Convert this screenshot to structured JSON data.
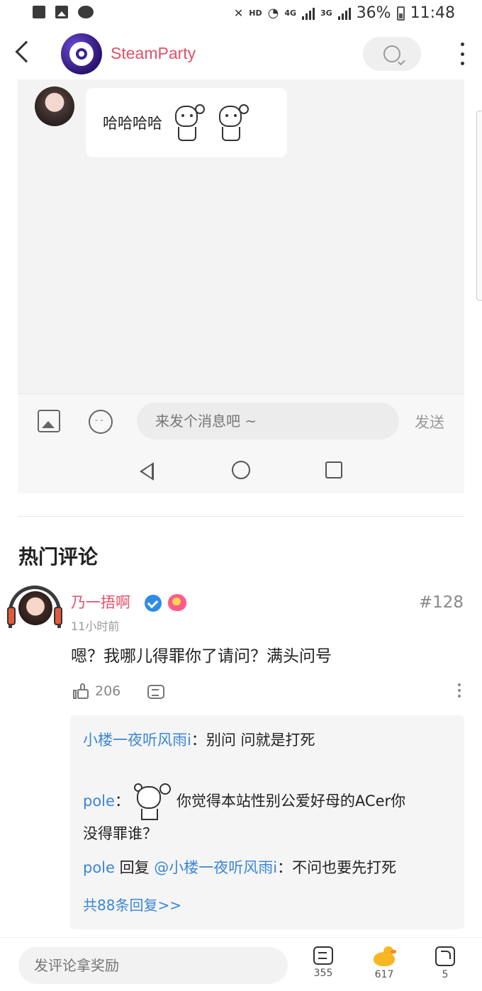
{
  "status_bar": {
    "net_label": "HD",
    "signal_4g": "4G",
    "signal_3g": "3G",
    "battery": "36%",
    "time": "11:48"
  },
  "header": {
    "title": "SteamParty"
  },
  "embedded_chat": {
    "message_text": "哈哈哈哈",
    "input_placeholder": "来发个消息吧 ~",
    "send_label": "发送"
  },
  "hot_comments": {
    "section_title": "热门评论",
    "comment": {
      "user": "乃一捂啊",
      "time": "11小时前",
      "floor": "#128",
      "text": "嗯？我哪儿得罪你了请问？满头问号",
      "likes": "206"
    },
    "replies": [
      {
        "user": "小楼一夜听风雨i",
        "sep": "：",
        "text": "别问 问就是打死"
      },
      {
        "user": "pole",
        "sep": "：",
        "text_line1": "你觉得本站性别公爱好母的ACer你",
        "text_line2": "没得罪谁？"
      },
      {
        "user": "pole",
        "mid": " 回复 ",
        "target": "@小楼一夜听风雨i",
        "sep": "：",
        "text": "不问也要先打死"
      }
    ],
    "more_replies": "共88条回复>>"
  },
  "bottom_bar": {
    "input_placeholder": "发评论拿奖励",
    "comment_count": "355",
    "duck_count": "617",
    "share_count": "5"
  },
  "colors": {
    "accent_pink": "#e2506a",
    "link_blue": "#3a86d6",
    "verified_blue": "#2f8be6"
  }
}
